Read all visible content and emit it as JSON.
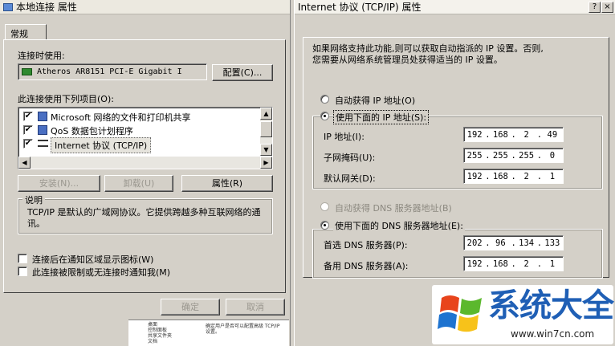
{
  "left_dialog": {
    "title": "本地连接 属性",
    "tab": "常规",
    "connect_using_label": "连接时使用:",
    "adapter": "Atheros AR8151 PCI-E Gigabit I",
    "configure_btn": "配置(C)...",
    "items_label": "此连接使用下列项目(O):",
    "items": [
      {
        "checked": "✔",
        "text": "Microsoft 网络的文件和打印机共享",
        "icon": "printer-share-icon"
      },
      {
        "checked": "✔",
        "text": "QoS 数据包计划程序",
        "icon": "qos-icon"
      },
      {
        "checked": "✔",
        "text": "Internet 协议 (TCP/IP)",
        "icon": "network-protocol-icon"
      }
    ],
    "install_btn": "安装(N)...",
    "uninstall_btn": "卸载(U)",
    "properties_btn": "属性(R)",
    "description_label": "说明",
    "description": "TCP/IP 是默认的广域网协议。它提供跨越多种互联网络的通讯。",
    "show_icon_label": "连接后在通知区域显示图标(W)",
    "notify_label": "此连接被限制或无连接时通知我(M)",
    "ok_btn": "确定",
    "cancel_btn": "取消"
  },
  "right_dialog": {
    "title": "Internet 协议 (TCP/IP) 属性",
    "help_btn": "?",
    "close_btn": "×",
    "intro_line1": "如果网络支持此功能,则可以获取自动指派的 IP 设置。否则,",
    "intro_line2": "您需要从网络系统管理员处获得适当的 IP 设置。",
    "auto_ip": "自动获得 IP 地址(O)",
    "manual_ip": "使用下面的 IP 地址(S):",
    "ip_label": "IP 地址(I):",
    "ip": [
      "192",
      "168",
      "2",
      "49"
    ],
    "mask_label": "子网掩码(U):",
    "mask": [
      "255",
      "255",
      "255",
      "0"
    ],
    "gateway_label": "默认网关(D):",
    "gateway": [
      "192",
      "168",
      "2",
      "1"
    ],
    "auto_dns": "自动获得 DNS 服务器地址(B)",
    "manual_dns": "使用下面的 DNS 服务器地址(E):",
    "dns1_label": "首选 DNS 服务器(P):",
    "dns1": [
      "202",
      "96",
      "134",
      "133"
    ],
    "dns2_label": "备用 DNS 服务器(A):",
    "dns2": [
      "192",
      "168",
      "2",
      "1"
    ]
  },
  "background_window": {
    "tree": [
      "桌面",
      "控制面板",
      "共享文件夹",
      "文档"
    ],
    "help_text": "确定用户是否可以配置高级 TCP/IP 设置。"
  },
  "watermark": {
    "brand": "系统大全",
    "url": "www.win7cn.com"
  },
  "colors": {
    "dialog": "#d4d0c8",
    "accent": "#0a246a",
    "watermark_blue": "#1f5fb5"
  }
}
